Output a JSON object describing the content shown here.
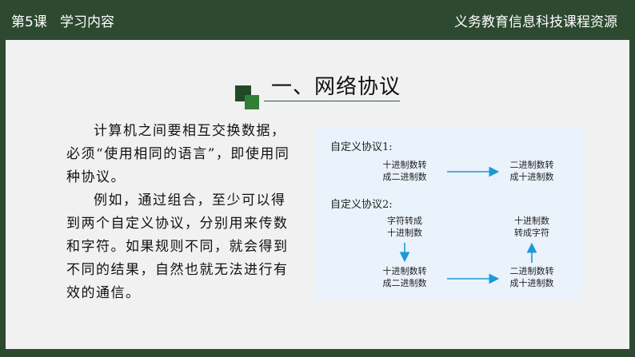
{
  "header": {
    "lesson": "第5课",
    "section": "学习内容",
    "course": "义务教育信息科技课程资源"
  },
  "main": {
    "title": "一、网络协议",
    "paragraphs": [
      "计算机之间要相互交换数据，必须“使用相同的语言”，即使用同种协议。",
      "例如，通过组合，至少可以得到两个自定义协议，分别用来传数和字符。如果规则不同，就会得到不同的结果，自然也就无法进行有效的通信。"
    ]
  },
  "diagram": {
    "protocol1": {
      "label": "自定义协议1:",
      "node_a": [
        "十进制数转",
        "成二进制数"
      ],
      "node_b": [
        "二进制数转",
        "成十进制数"
      ]
    },
    "protocol2": {
      "label": "自定义协议2:",
      "node_a": [
        "字符转成",
        "十进制数"
      ],
      "node_b": [
        "十进制数转",
        "成二进制数"
      ],
      "node_c": [
        "二进制数转",
        "成十进制数"
      ],
      "node_d": [
        "十进制数",
        "转成字符"
      ]
    },
    "arrow_color": "#1a9ad6"
  },
  "colors": {
    "header_bg": "#2d4a31",
    "slide_bg": "#f1f1f1",
    "panel_bg": "#eaf2fb"
  }
}
